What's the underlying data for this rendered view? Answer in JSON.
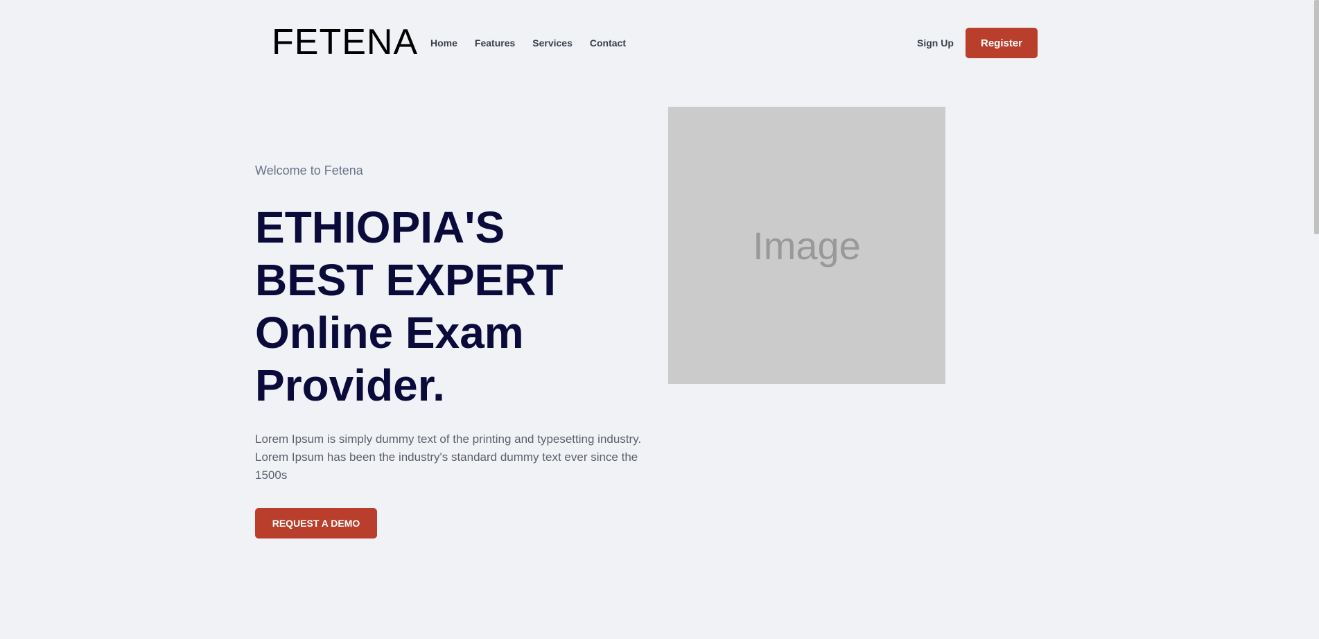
{
  "header": {
    "logo": "FETENA",
    "nav": [
      "Home",
      "Features",
      "Services",
      "Contact"
    ],
    "sign_up": "Sign Up",
    "register": "Register"
  },
  "hero": {
    "welcome": "Welcome to Fetena",
    "headline_lines": [
      "ETHIOPIA'S",
      "BEST EXPERT",
      "Online Exam",
      "Provider."
    ],
    "description": "Lorem Ipsum is simply dummy text of the printing and typesetting industry. Lorem Ipsum has been the industry's standard dummy text ever since the 1500s",
    "cta": "REQUEST A DEMO",
    "image_placeholder": "Image"
  },
  "colors": {
    "background": "#f0f2f6",
    "accent": "#b93e2c",
    "headline": "#0b0b3b"
  }
}
